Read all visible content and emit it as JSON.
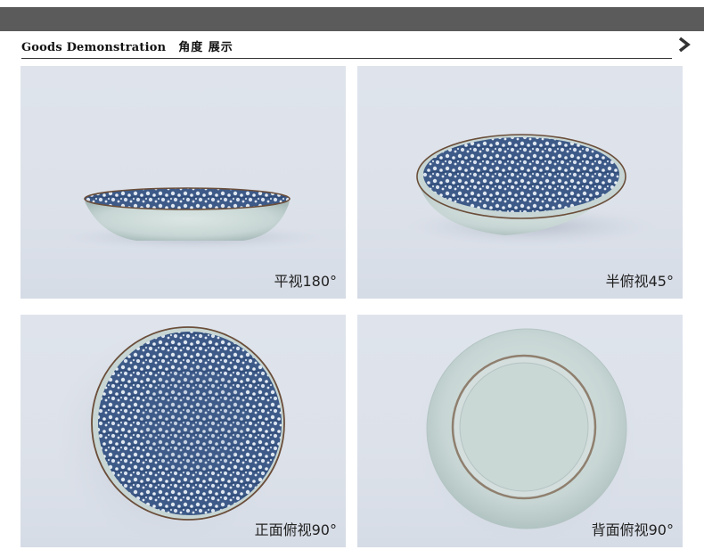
{
  "header": {
    "title_en": "Goods Demonstration",
    "title_cn": "角度 展示"
  },
  "icons": {
    "arrow": "chevron-right-icon"
  },
  "colors": {
    "top_bar": "#5b5b5b",
    "pattern_blue": "#3d5a88",
    "glaze": "#c9d8d6",
    "rim": "#6b4e3a"
  },
  "photos": [
    {
      "caption": "平视180°"
    },
    {
      "caption": "半俯视45°"
    },
    {
      "caption": "正面俯视90°"
    },
    {
      "caption": "背面俯视90°"
    }
  ]
}
